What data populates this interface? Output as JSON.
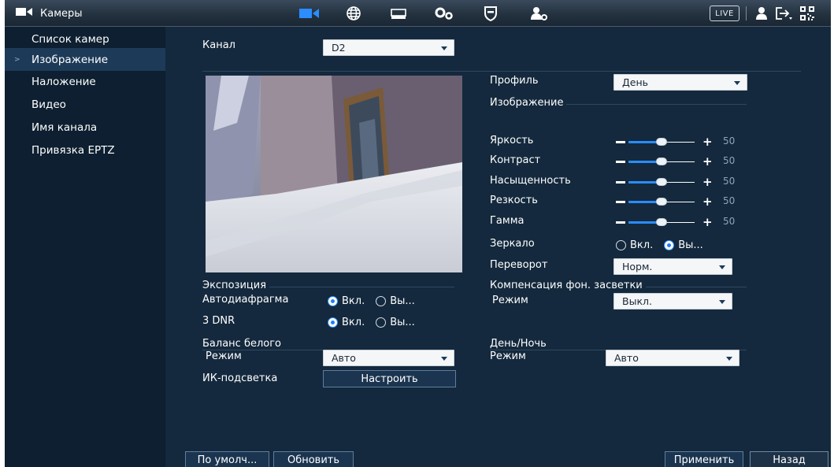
{
  "header": {
    "app_title": "Камеры",
    "live_label": "LIVE",
    "icons": [
      "camera-icon",
      "network-icon",
      "storage-icon",
      "settings-icon",
      "security-icon",
      "account-icon"
    ],
    "right_icons": [
      "user-icon",
      "logout-icon",
      "qr-code-icon"
    ]
  },
  "sidebar": {
    "items": [
      {
        "label": "Список камер"
      },
      {
        "label": "Изображение",
        "active": true
      },
      {
        "label": "Наложение"
      },
      {
        "label": "Видео"
      },
      {
        "label": "Имя канала"
      },
      {
        "label": "Привязка EPTZ"
      }
    ]
  },
  "channel": {
    "label": "Канал",
    "value": "D2"
  },
  "profile": {
    "label": "Профиль",
    "value": "День"
  },
  "image_section": {
    "title": "Изображение"
  },
  "sliders": [
    {
      "label": "Яркость",
      "value": "50",
      "level": 0.5
    },
    {
      "label": "Контраст",
      "value": "50",
      "level": 0.5
    },
    {
      "label": "Насыщенность",
      "value": "50",
      "level": 0.5
    },
    {
      "label": "Резкость",
      "value": "50",
      "level": 0.5
    },
    {
      "label": "Гамма",
      "value": "50",
      "level": 0.5
    }
  ],
  "mirror": {
    "label": "Зеркало",
    "options": [
      "Вкл.",
      "Вы..."
    ],
    "selected": 1
  },
  "flip": {
    "label": "Переворот",
    "value": "Норм."
  },
  "exposure": {
    "title": "Экспозиция"
  },
  "auto_iris": {
    "label": "Автодиафрагма",
    "options": [
      "Вкл.",
      "Вы..."
    ],
    "selected": 0
  },
  "dnr": {
    "label": "3 DNR",
    "options": [
      "Вкл.",
      "Вы..."
    ],
    "selected": 0
  },
  "white_balance": {
    "title": "Баланс белого",
    "mode_label": "Режим",
    "mode_value": "Авто"
  },
  "ir_light": {
    "label": "ИК-подсветка",
    "button": "Настроить"
  },
  "backlight": {
    "title": "Компенсация фон. засветки",
    "mode_label": "Режим",
    "mode_value": "Выкл."
  },
  "day_night": {
    "title": "День/Ночь",
    "mode_label": "Режим",
    "mode_value": "Авто"
  },
  "footer": {
    "default_button": "По умолч...",
    "refresh_button": "Обновить",
    "apply_button": "Применить",
    "back_button": "Назад"
  },
  "colors": {
    "accent": "#2a8cff",
    "panel": "#14293d",
    "sidebar": "#0d1f30",
    "active_item": "#1d3b58"
  }
}
